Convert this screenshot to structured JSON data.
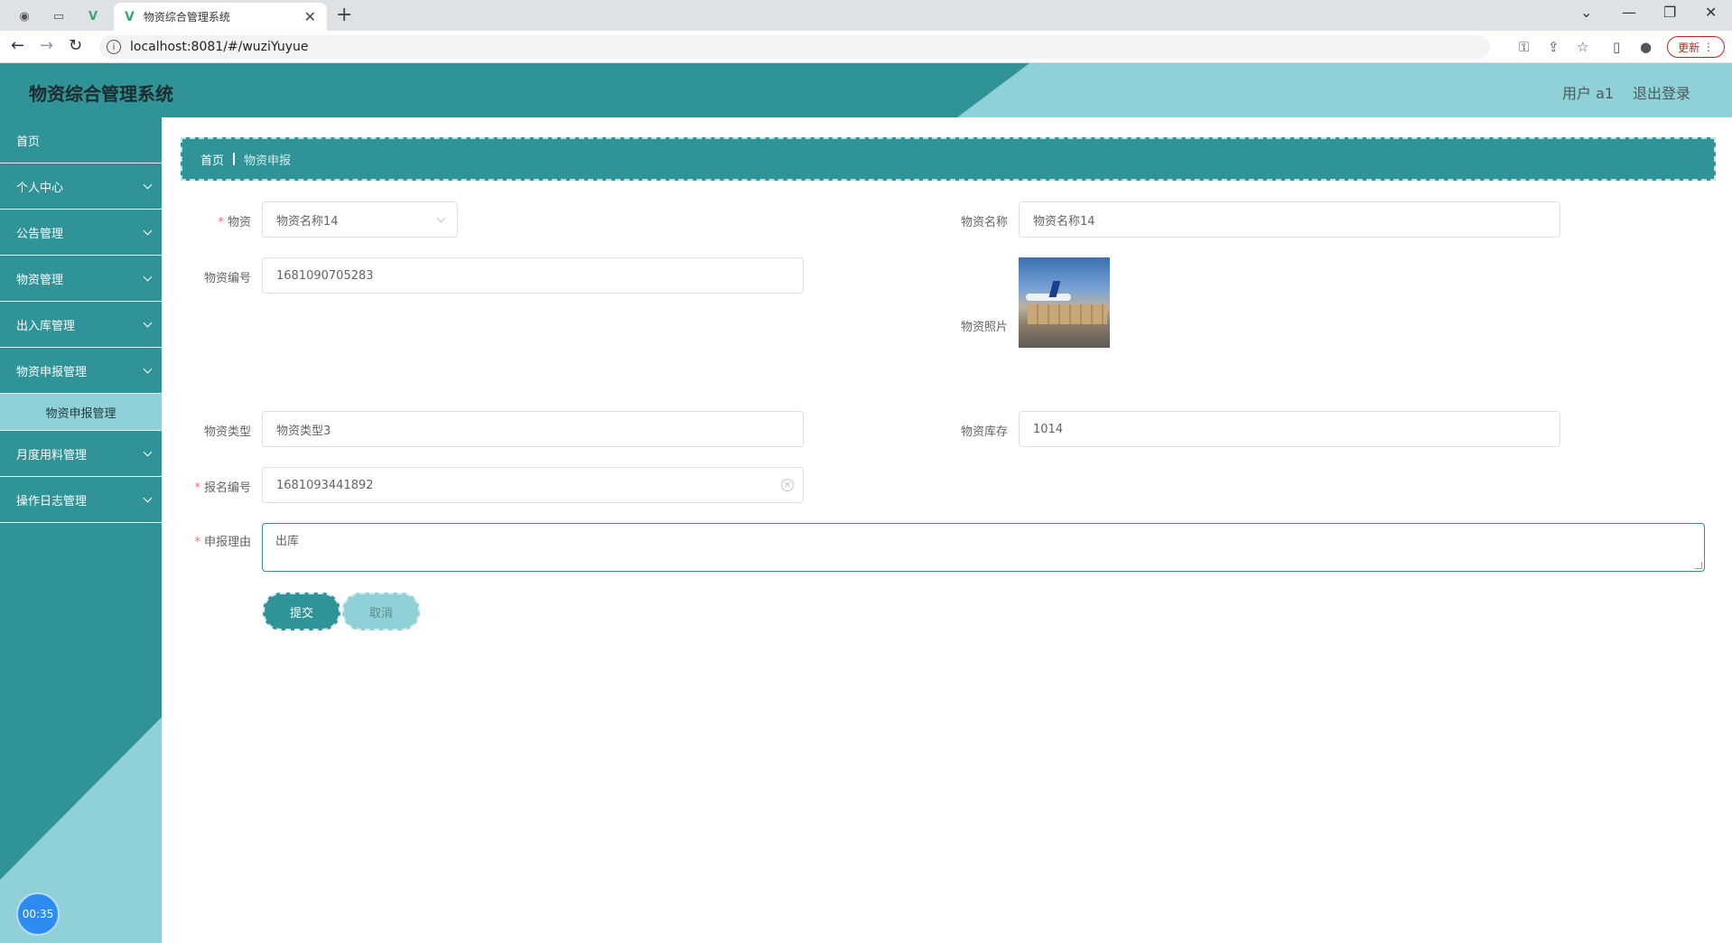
{
  "browser": {
    "tab_title": "物资综合管理系统",
    "url": "localhost:8081/#/wuziYuyue",
    "update_label": "更新"
  },
  "header": {
    "app_title": "物资综合管理系统",
    "user_label": "用户 a1",
    "logout_label": "退出登录"
  },
  "sidebar": {
    "items": [
      {
        "label": "首页"
      },
      {
        "label": "个人中心"
      },
      {
        "label": "公告管理"
      },
      {
        "label": "物资管理"
      },
      {
        "label": "出入库管理"
      },
      {
        "label": "物资申报管理"
      },
      {
        "label": "物资申报管理"
      },
      {
        "label": "月度用料管理"
      },
      {
        "label": "操作日志管理"
      }
    ],
    "timer": "00:35"
  },
  "breadcrumb": {
    "home": "首页",
    "current": "物资申报"
  },
  "form": {
    "wuzi_label": "物资",
    "wuzi_value": "物资名称14",
    "wuzi_name_label": "物资名称",
    "wuzi_name_value": "物资名称14",
    "wuzi_code_label": "物资编号",
    "wuzi_code_value": "1681090705283",
    "wuzi_photo_label": "物资照片",
    "wuzi_type_label": "物资类型",
    "wuzi_type_value": "物资类型3",
    "wuzi_stock_label": "物资库存",
    "wuzi_stock_value": "1014",
    "baoming_code_label": "报名编号",
    "baoming_code_value": "1681093441892",
    "reason_label": "申报理由",
    "reason_value": "出库",
    "submit_label": "提交",
    "cancel_label": "取消"
  }
}
